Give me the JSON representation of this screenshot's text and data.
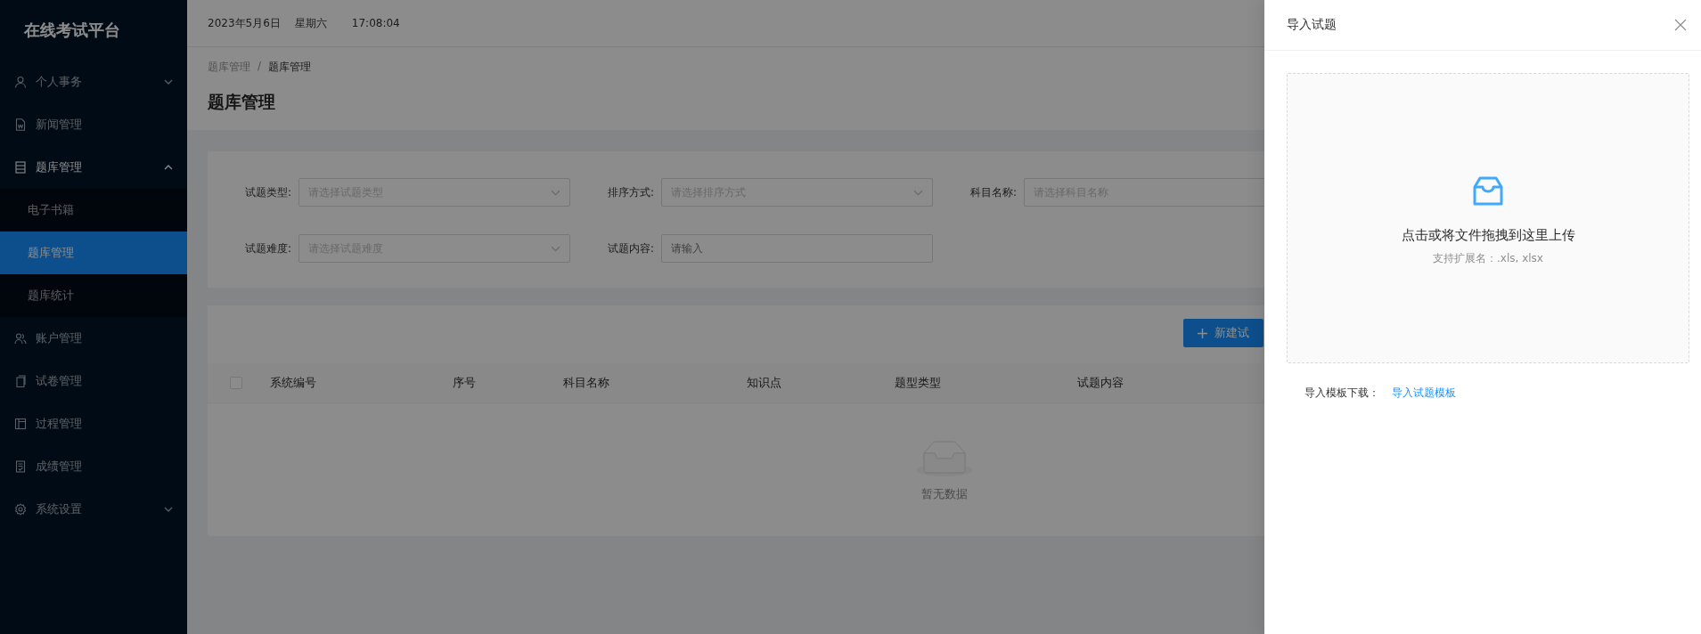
{
  "sidebar": {
    "title": "在线考试平台",
    "menu": [
      {
        "label": "个人事务",
        "kind": "submenu",
        "expanded": false,
        "selected": false
      },
      {
        "label": "新闻管理",
        "kind": "item",
        "selected": false
      },
      {
        "label": "题库管理",
        "kind": "submenu",
        "expanded": true,
        "selected": false,
        "children": [
          {
            "label": "电子书籍",
            "selected": false
          },
          {
            "label": "题库管理",
            "selected": true
          },
          {
            "label": "题库统计",
            "selected": false
          }
        ]
      },
      {
        "label": "账户管理",
        "kind": "item",
        "selected": false
      },
      {
        "label": "试卷管理",
        "kind": "item",
        "selected": false
      },
      {
        "label": "过程管理",
        "kind": "item",
        "selected": false
      },
      {
        "label": "成绩管理",
        "kind": "item",
        "selected": false
      },
      {
        "label": "系统设置",
        "kind": "submenu",
        "expanded": false,
        "selected": false
      }
    ]
  },
  "header": {
    "date": "2023年5月6日",
    "weekday": "星期六",
    "time": "17:08:04"
  },
  "breadcrumb": [
    "题库管理",
    "题库管理"
  ],
  "breadcrumb_separator": "/",
  "page_title": "题库管理",
  "filters": [
    {
      "label": "试题类型:",
      "kind": "select",
      "placeholder": "请选择试题类型"
    },
    {
      "label": "排序方式:",
      "kind": "select",
      "placeholder": "请选择排序方式"
    },
    {
      "label": "科目名称:",
      "kind": "select",
      "placeholder": "请选择科目名称"
    },
    {
      "label": "试题难度:",
      "kind": "select",
      "placeholder": "请选择试题难度"
    },
    {
      "label": "试题内容:",
      "kind": "input",
      "placeholder": "请输入"
    }
  ],
  "table": {
    "new_button": "新建试",
    "select_all_checked": false,
    "columns": [
      "系统编号",
      "序号",
      "科目名称",
      "知识点",
      "题型类型",
      "试题内容"
    ],
    "empty_text": "暂无数据"
  },
  "drawer": {
    "title": "导入试题",
    "upload_text": "点击或将文件拖拽到这里上传",
    "upload_hint": "支持扩展名：.xls, xlsx",
    "template_label": "导入模板下载：",
    "template_link": "导入试题模板"
  }
}
